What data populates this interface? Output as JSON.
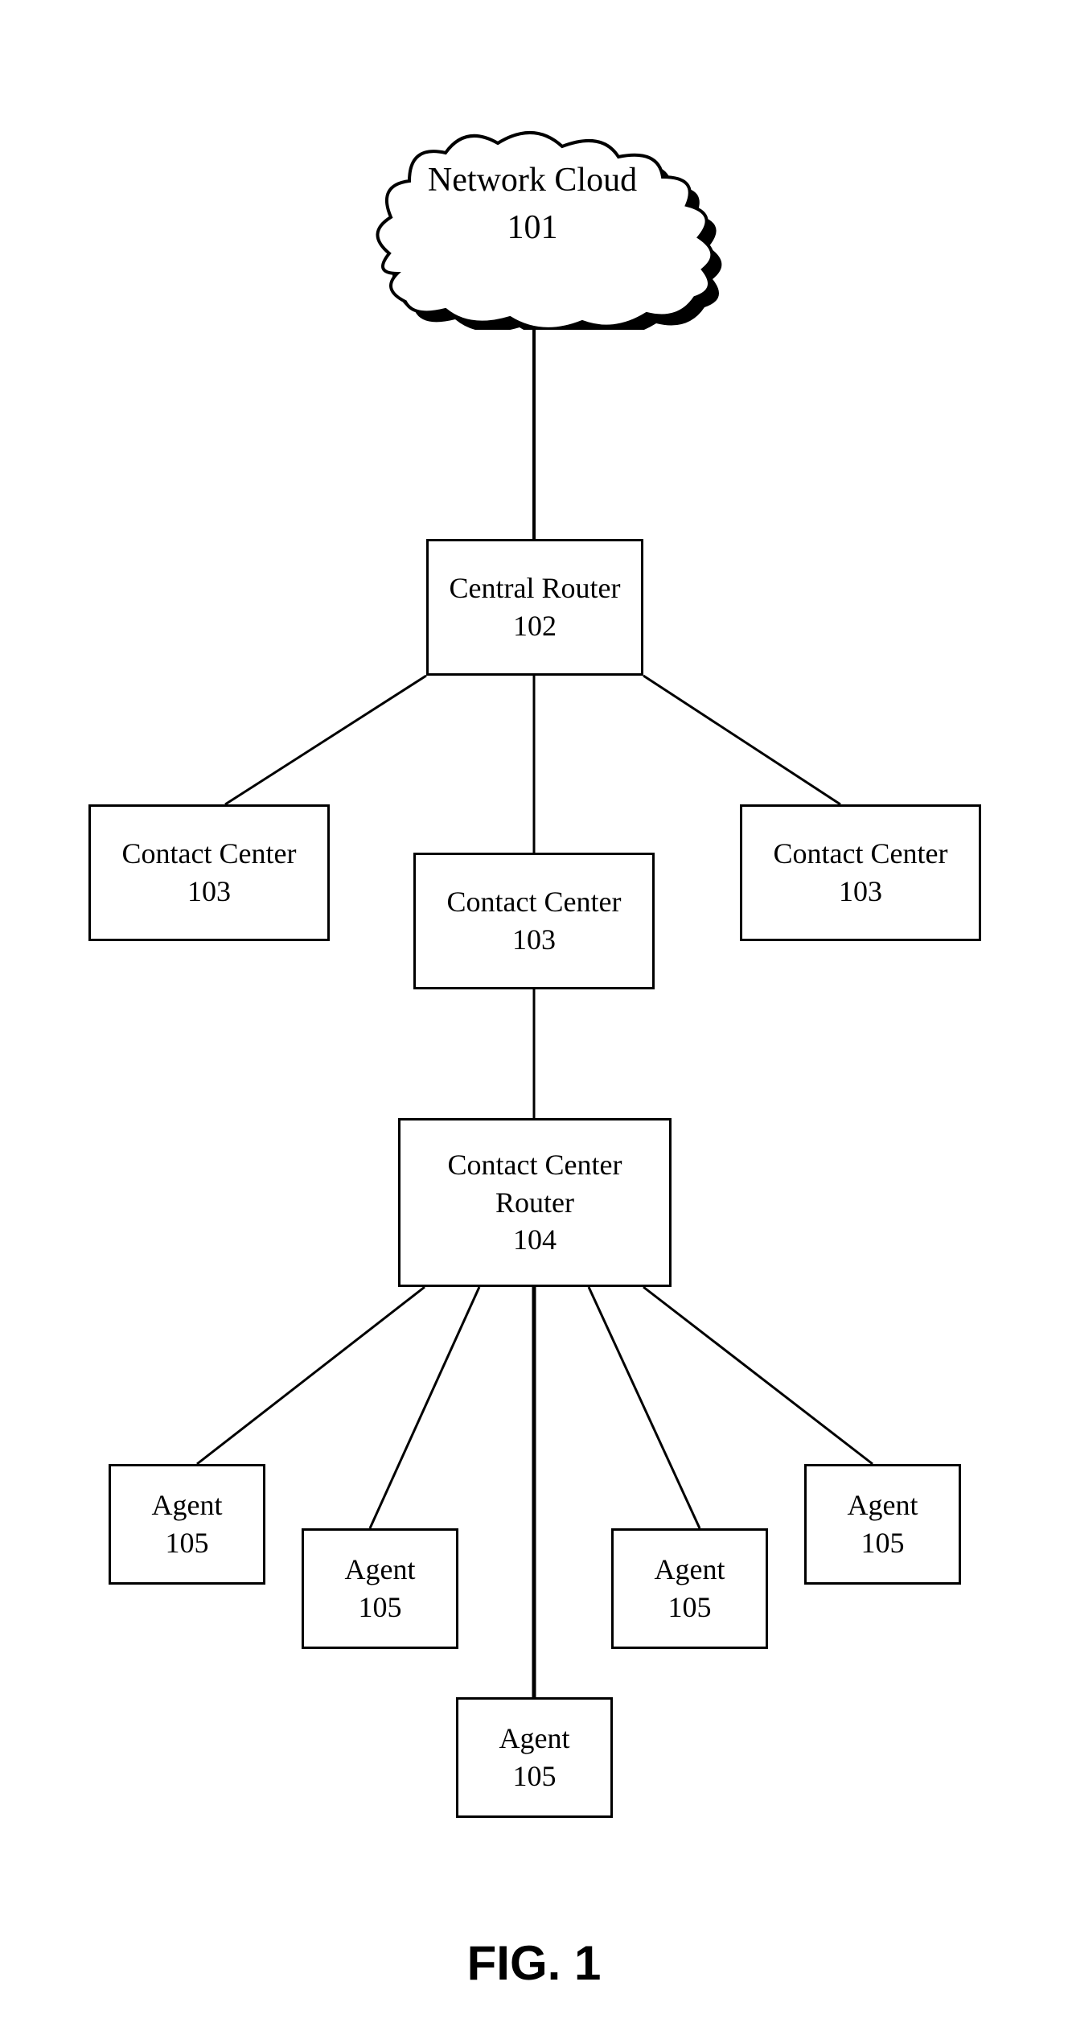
{
  "figure_label": "FIG. 1",
  "nodes": {
    "cloud": {
      "label": "Network Cloud",
      "number": "101"
    },
    "central_router": {
      "label": "Central Router",
      "number": "102"
    },
    "contact_center_left": {
      "label": "Contact Center",
      "number": "103"
    },
    "contact_center_mid": {
      "label": "Contact Center",
      "number": "103"
    },
    "contact_center_right": {
      "label": "Contact Center",
      "number": "103"
    },
    "cc_router": {
      "label": "Contact Center\nRouter",
      "number": "104"
    },
    "agent_1": {
      "label": "Agent",
      "number": "105"
    },
    "agent_2": {
      "label": "Agent",
      "number": "105"
    },
    "agent_3": {
      "label": "Agent",
      "number": "105"
    },
    "agent_4": {
      "label": "Agent",
      "number": "105"
    },
    "agent_5": {
      "label": "Agent",
      "number": "105"
    }
  }
}
